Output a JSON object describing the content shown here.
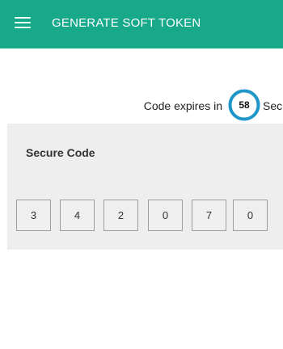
{
  "header": {
    "title": "GENERATE SOFT TOKEN",
    "background": "#18a88a",
    "menu_icon": "hamburger-menu-icon"
  },
  "expiry": {
    "label": "Code expires in",
    "seconds": "58",
    "unit_label": "Sec",
    "ring_color": "#1e96c8",
    "ring_fraction": 0.97
  },
  "secure_code": {
    "title": "Secure Code",
    "digits": [
      "3",
      "4",
      "2",
      "0",
      "7",
      "0"
    ],
    "panel_background": "#eeeeee"
  }
}
